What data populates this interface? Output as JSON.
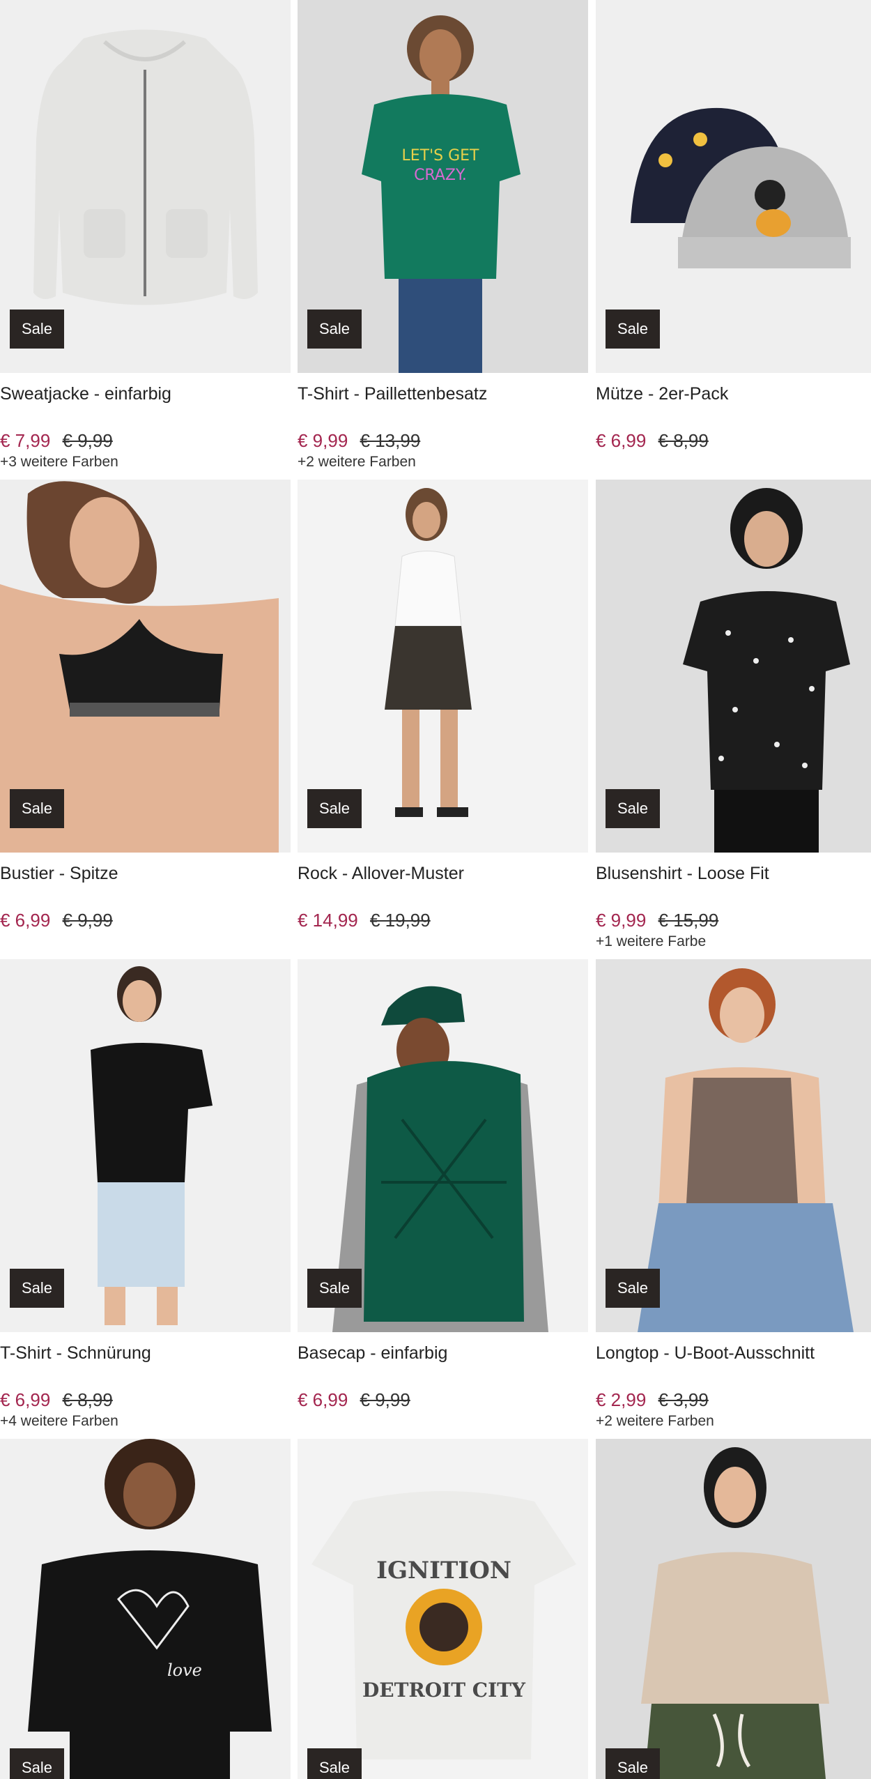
{
  "sale_label": "Sale",
  "colors": {
    "price": "#a3264f",
    "badge_bg": "#2a2523"
  },
  "products": [
    {
      "title": "Sweatjacke - einfarbig",
      "price": "€ 7,99",
      "old_price": "€ 9,99",
      "more_colors": "+3 weitere Farben",
      "icon": "hoodie-image"
    },
    {
      "title": "T-Shirt - Paillettenbesatz",
      "price": "€ 9,99",
      "old_price": "€ 13,99",
      "more_colors": "+2 weitere Farben",
      "icon": "model-tshirt-image"
    },
    {
      "title": "Mütze - 2er-Pack",
      "price": "€ 6,99",
      "old_price": "€ 8,99",
      "more_colors": "",
      "icon": "beanie-image"
    },
    {
      "title": "Bustier - Spitze",
      "price": "€ 6,99",
      "old_price": "€ 9,99",
      "more_colors": "",
      "icon": "model-bustier-image"
    },
    {
      "title": "Rock - Allover-Muster",
      "price": "€ 14,99",
      "old_price": "€ 19,99",
      "more_colors": "",
      "icon": "model-skirt-image"
    },
    {
      "title": "Blusenshirt - Loose Fit",
      "price": "€ 9,99",
      "old_price": "€ 15,99",
      "more_colors": "+1 weitere Farbe",
      "icon": "model-blouse-image"
    },
    {
      "title": "T-Shirt - Schnürung",
      "price": "€ 6,99",
      "old_price": "€ 8,99",
      "more_colors": "+4 weitere Farben",
      "icon": "model-tshirt-image"
    },
    {
      "title": "Basecap - einfarbig",
      "price": "€ 6,99",
      "old_price": "€ 9,99",
      "more_colors": "",
      "icon": "model-cap-image"
    },
    {
      "title": "Longtop - U-Boot-Ausschnitt",
      "price": "€ 2,99",
      "old_price": "€ 3,99",
      "more_colors": "+2 weitere Farben",
      "icon": "model-longtop-image"
    },
    {
      "title": "",
      "price": "",
      "old_price": "",
      "more_colors": "",
      "icon": "model-sweater-image"
    },
    {
      "title": "",
      "price": "",
      "old_price": "",
      "more_colors": "",
      "icon": "graphic-tshirt-image"
    },
    {
      "title": "",
      "price": "",
      "old_price": "",
      "more_colors": "",
      "icon": "model-blouse-image"
    }
  ]
}
